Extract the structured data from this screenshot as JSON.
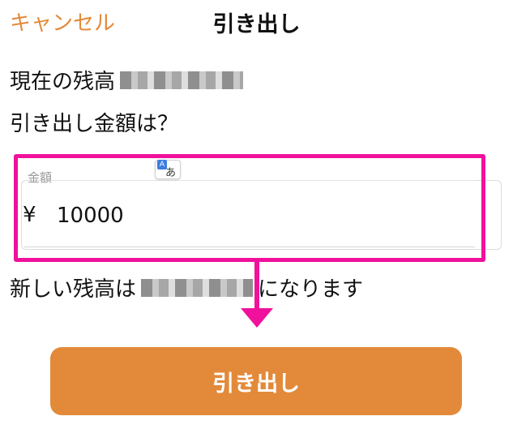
{
  "header": {
    "cancel_label": "キャンセル",
    "title": "引き出し"
  },
  "balance": {
    "label": "現在の残高"
  },
  "question": {
    "text": "引き出し金額は？"
  },
  "amount_field": {
    "label": "金額",
    "currency_symbol": "¥",
    "value": "10000"
  },
  "new_balance": {
    "prefix": "新しい残高は",
    "suffix": "になります"
  },
  "translate_chip": {
    "kana": "あ"
  },
  "withdraw_button": {
    "label": "引き出し"
  },
  "colors": {
    "accent": "#e38a3a",
    "highlight": "#f0119c"
  }
}
